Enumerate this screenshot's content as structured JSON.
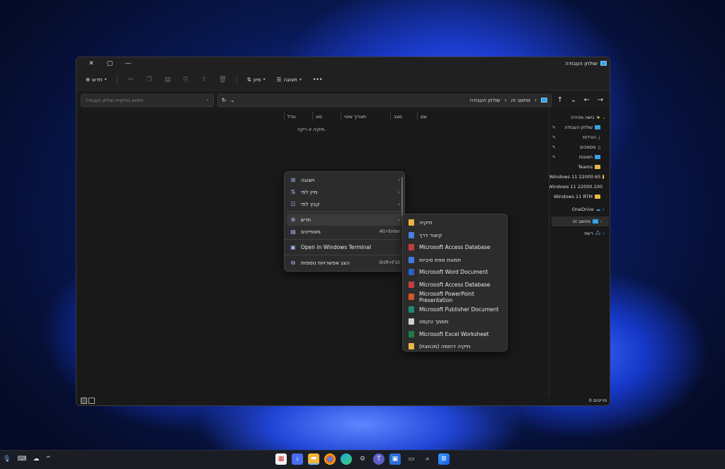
{
  "window": {
    "title": "שולחן העבודה",
    "controls": {
      "close": "✕",
      "maximize": "▢",
      "minimize": "—"
    }
  },
  "toolbar": {
    "new_label": "חדש",
    "sort_label": "מיון",
    "view_label": "תצוגה",
    "more_label": "•••"
  },
  "address": {
    "search_placeholder": "חיפוש בתיקיית שולחן העבודה",
    "crumbs": [
      "מחשב זה",
      "שולחן העבודה"
    ]
  },
  "columns": [
    "שם",
    "מצב",
    "תאריך שינוי",
    "סוג",
    "גודל"
  ],
  "empty_message": "תיקיה זו ריקה.",
  "nav": {
    "quick_access": "גישה מהירה",
    "items": [
      {
        "label": "שולחן העבודה",
        "icon": "desktop-icon"
      },
      {
        "label": "הורדות",
        "icon": "download-icon"
      },
      {
        "label": "מסמכים",
        "icon": "document-icon"
      },
      {
        "label": "תמונות",
        "icon": "picture-icon"
      },
      {
        "label": "Teams",
        "icon": "folder-icon"
      },
      {
        "label": "Windows 11 22000.65",
        "icon": "folder-icon"
      },
      {
        "label": "Windows 11 22000.100",
        "icon": "folder-icon"
      },
      {
        "label": "Windows 11 RTM",
        "icon": "folder-icon"
      }
    ],
    "onedrive": "OneDrive",
    "this_pc": "מחשב זה",
    "network": "רשת"
  },
  "status": {
    "items": "0 פריטים"
  },
  "context_menu": {
    "items": [
      {
        "label": "תצוגה",
        "icon": "grid-icon"
      },
      {
        "label": "מיין לפי",
        "icon": "sort-icon"
      },
      {
        "label": "קבץ לפי",
        "icon": "group-icon"
      },
      {
        "label": "חדש",
        "icon": "new-icon"
      },
      {
        "label": "מאפיינים",
        "icon": "properties-icon",
        "shortcut": "Alt+Enter"
      },
      {
        "label": "Open in Windows Terminal",
        "icon": "terminal-icon"
      },
      {
        "label": "הצג אפשרויות נוספות",
        "icon": "more-options-icon",
        "shortcut": "Shift+F10"
      }
    ]
  },
  "submenu": {
    "items": [
      {
        "label": "תיקיה",
        "color": "#e9b548"
      },
      {
        "label": "קיצור דרך",
        "color": "#4a7fe0"
      },
      {
        "label": "Microsoft Access Database",
        "color": "#c43e3e"
      },
      {
        "label": "תמונת מפת סיביות",
        "color": "#3d7be0"
      },
      {
        "label": "Microsoft Word Document",
        "color": "#2b5fcf"
      },
      {
        "label": "Microsoft Access Database",
        "color": "#c43e3e"
      },
      {
        "label": "Microsoft PowerPoint Presentation",
        "color": "#d2572e"
      },
      {
        "label": "Microsoft Publisher Document",
        "color": "#1e8a7a"
      },
      {
        "label": "מסמך טקסט",
        "color": "#cfcfcf"
      },
      {
        "label": "Microsoft Excel Worksheet",
        "color": "#1f7b45"
      },
      {
        "label": "תיקיה דחוסה (מכווצת)",
        "color": "#e9b548"
      }
    ]
  },
  "taskbar": {
    "badge": "1"
  }
}
